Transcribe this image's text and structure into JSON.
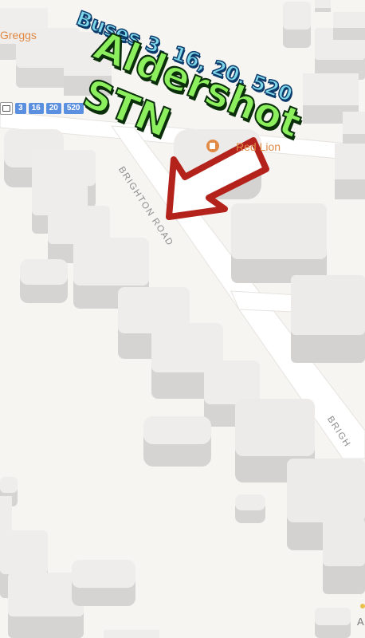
{
  "map": {
    "poi_greggs": "Greggs",
    "poi_pub": "Red Lion",
    "road_label_1": "BRIGHTON ROAD",
    "road_label_2": "BRIGH",
    "bus_routes": [
      "3",
      "16",
      "20",
      "520"
    ],
    "partial_label": "A"
  },
  "overlay": {
    "buses_text": "Buses 3, 16, 20, 520",
    "station_line1": "Aldershot",
    "station_line2": "STN"
  },
  "colors": {
    "arrow": "#b3221b",
    "bus_badge": "#5b8fe0",
    "poi": "#e08a45",
    "overlay_green": "#8cf05e",
    "overlay_cyan": "#7fd8ea"
  },
  "icons": [
    "bus-icon",
    "pub-icon",
    "arrow-icon"
  ]
}
